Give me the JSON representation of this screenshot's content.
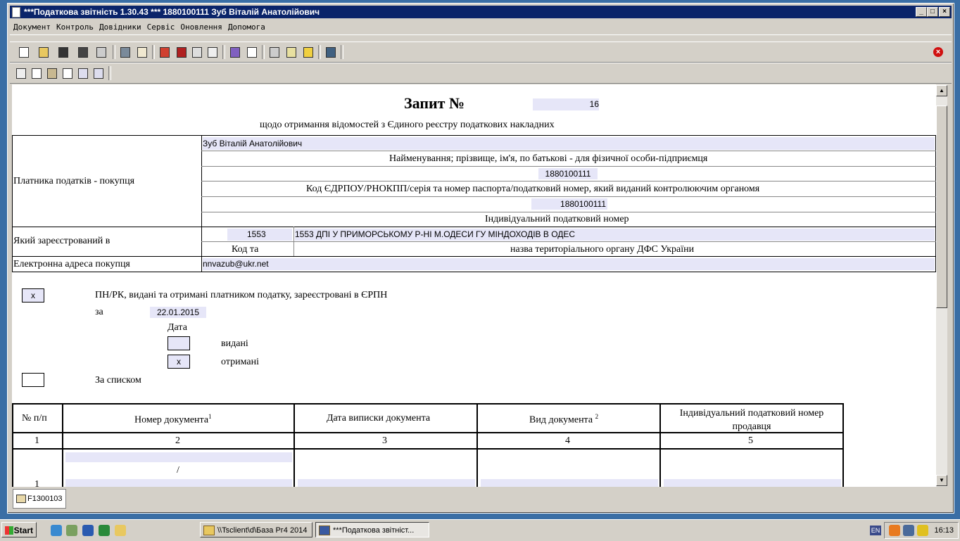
{
  "window": {
    "title": "***Податкова звітність 1.30.43 *** 1880100111 Зуб Віталій Анатолійович"
  },
  "menu": [
    "Документ",
    "Контроль",
    "Довідники",
    "Сервіс",
    "Оновлення",
    "Допомога"
  ],
  "form": {
    "heading": "Запит №",
    "number": "16",
    "subtitle": "щодо отримання відомостей з Єдиного реєстру податкових накладних",
    "buyer_label": "Платника податків - покупця",
    "buyer_name": "Зуб Віталій Анатолійович",
    "name_caption": "Найменування; прізвище, ім'я, по батькові - для фізичної особи-підприємця",
    "edrpou": "1880100111",
    "edrpou_caption": "Код ЄДРПОУ/РНОКПП/серія та номер паспорта/податковий номер, який виданий контролюючим органомя",
    "ipn": "1880100111",
    "ipn_caption": "Індивідуальний податковий номер",
    "registered_label": "Який зареєстрований в",
    "tax_code": "1553",
    "tax_office": "1553 ДПІ У ПРИМОРСЬКОМУ Р-НІ М.ОДЕСИ ГУ МІНДОХОДІВ В ОДЕС",
    "code_caption_left": "Код та",
    "code_caption_right": "назва територіального органу ДФС України",
    "email_label": "Електронна адреса покупця",
    "email": "nnvazub@ukr.net",
    "option1_check": "x",
    "option1_text": "ПН/РК, видані та отримані платником податку, зареєстровані в ЄРПН",
    "za": "за",
    "date": "22.01.2015",
    "date_caption": "Дата",
    "issued_check": "",
    "issued_label": "видані",
    "received_check": "x",
    "received_label": "отримані",
    "list_check": "",
    "list_label": "За списком"
  },
  "table": {
    "headers": [
      "№ п/п",
      "Номер документа",
      "Дата виписки документа",
      "Вид документа",
      "Індивідуальний податковий номер продавця"
    ],
    "sup1": "1",
    "sup2": "2",
    "numbers": [
      "1",
      "2",
      "3",
      "4",
      "5"
    ],
    "row1_num": "1",
    "row1_slash": "/"
  },
  "tab": {
    "label": "F1300103"
  },
  "taskbar": {
    "start": "Start",
    "tasks": [
      "\\\\Tsclient\\d\\База Рг4 2014",
      "***Податкова звітніст..."
    ],
    "lang": "EN",
    "clock": "16:13"
  }
}
